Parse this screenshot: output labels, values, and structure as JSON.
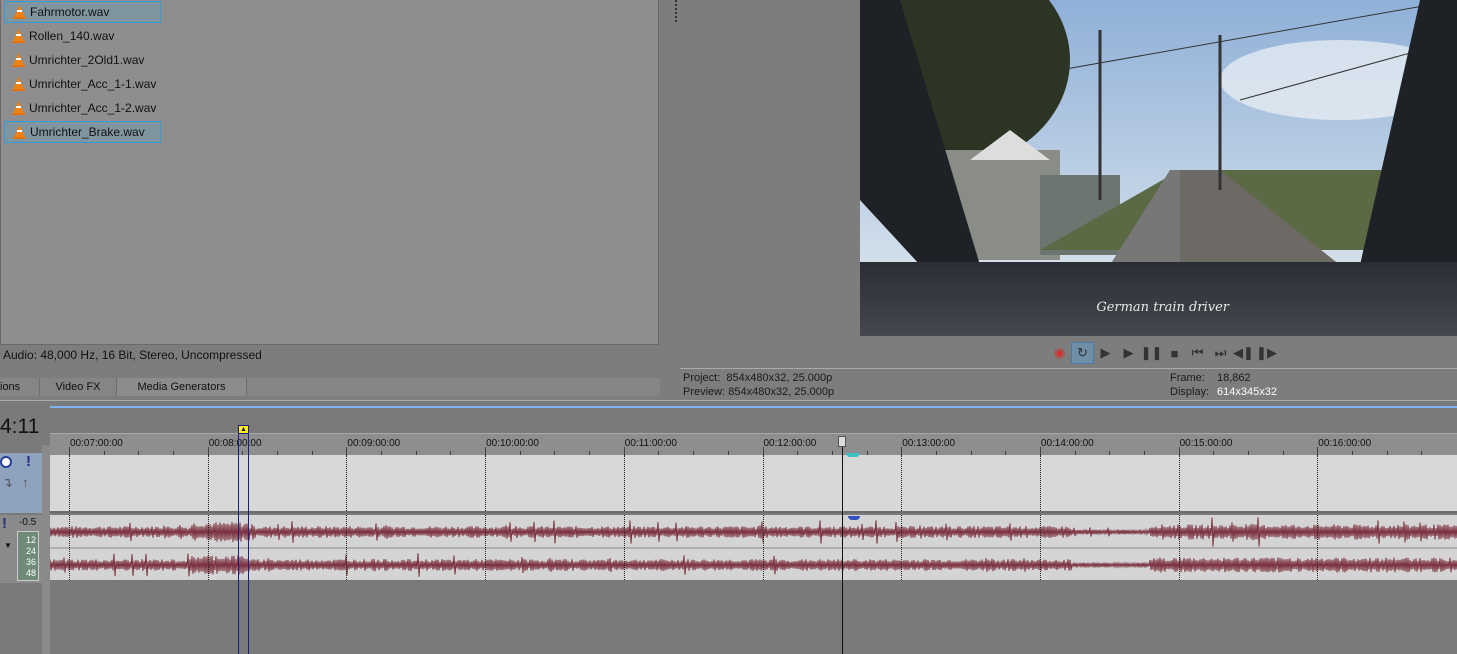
{
  "media": {
    "files": [
      {
        "name": "Fahrmotor.wav",
        "selected": true
      },
      {
        "name": "Rollen_140.wav",
        "selected": false
      },
      {
        "name": "Umrichter_2Old1.wav",
        "selected": false
      },
      {
        "name": "Umrichter_Acc_1-1.wav",
        "selected": false
      },
      {
        "name": "Umrichter_Acc_1-2.wav",
        "selected": false
      },
      {
        "name": "Umrichter_Brake.wav",
        "selected": true
      }
    ],
    "audio_info": "Audio: 48,000 Hz, 16 Bit, Stereo, Uncompressed"
  },
  "tabs": [
    "ions",
    "Video FX",
    "Media Generators"
  ],
  "preview": {
    "caption": "German train driver",
    "project_label": "Project:",
    "project_value": "854x480x32, 25.000p",
    "preview_label": "Preview:",
    "preview_value": "854x480x32, 25.000p",
    "frame_label": "Frame:",
    "frame_value": "18,862",
    "display_label": "Display:",
    "display_value": "614x345x32"
  },
  "transport": [
    {
      "name": "record",
      "glyph": "◉"
    },
    {
      "name": "loop",
      "glyph": "↻"
    },
    {
      "name": "play-from-start",
      "glyph": "▶"
    },
    {
      "name": "play",
      "glyph": "▶"
    },
    {
      "name": "pause",
      "glyph": "❚❚"
    },
    {
      "name": "stop",
      "glyph": "■"
    },
    {
      "name": "prev-marker",
      "glyph": "⏮"
    },
    {
      "name": "next-marker",
      "glyph": "⏭"
    },
    {
      "name": "prev-frame",
      "glyph": "◀❚"
    },
    {
      "name": "next-frame",
      "glyph": "❚▶"
    }
  ],
  "timeline": {
    "timecode": "4:11",
    "ruler": [
      "00:07:00:00",
      "00:08:00:00",
      "00:09:00:00",
      "00:10:00:00",
      "00:11:00:00",
      "00:12:00:00",
      "00:13:00:00",
      "00:14:00:00",
      "00:15:00:00",
      "00:16:00:00"
    ],
    "audio_level": "-0.5",
    "meter": [
      "12",
      "24",
      "36",
      "48"
    ]
  },
  "colors": {
    "waveform": "#7a2e3c",
    "selection": "#3a9ad6",
    "cursor": "#1a1a8c"
  }
}
